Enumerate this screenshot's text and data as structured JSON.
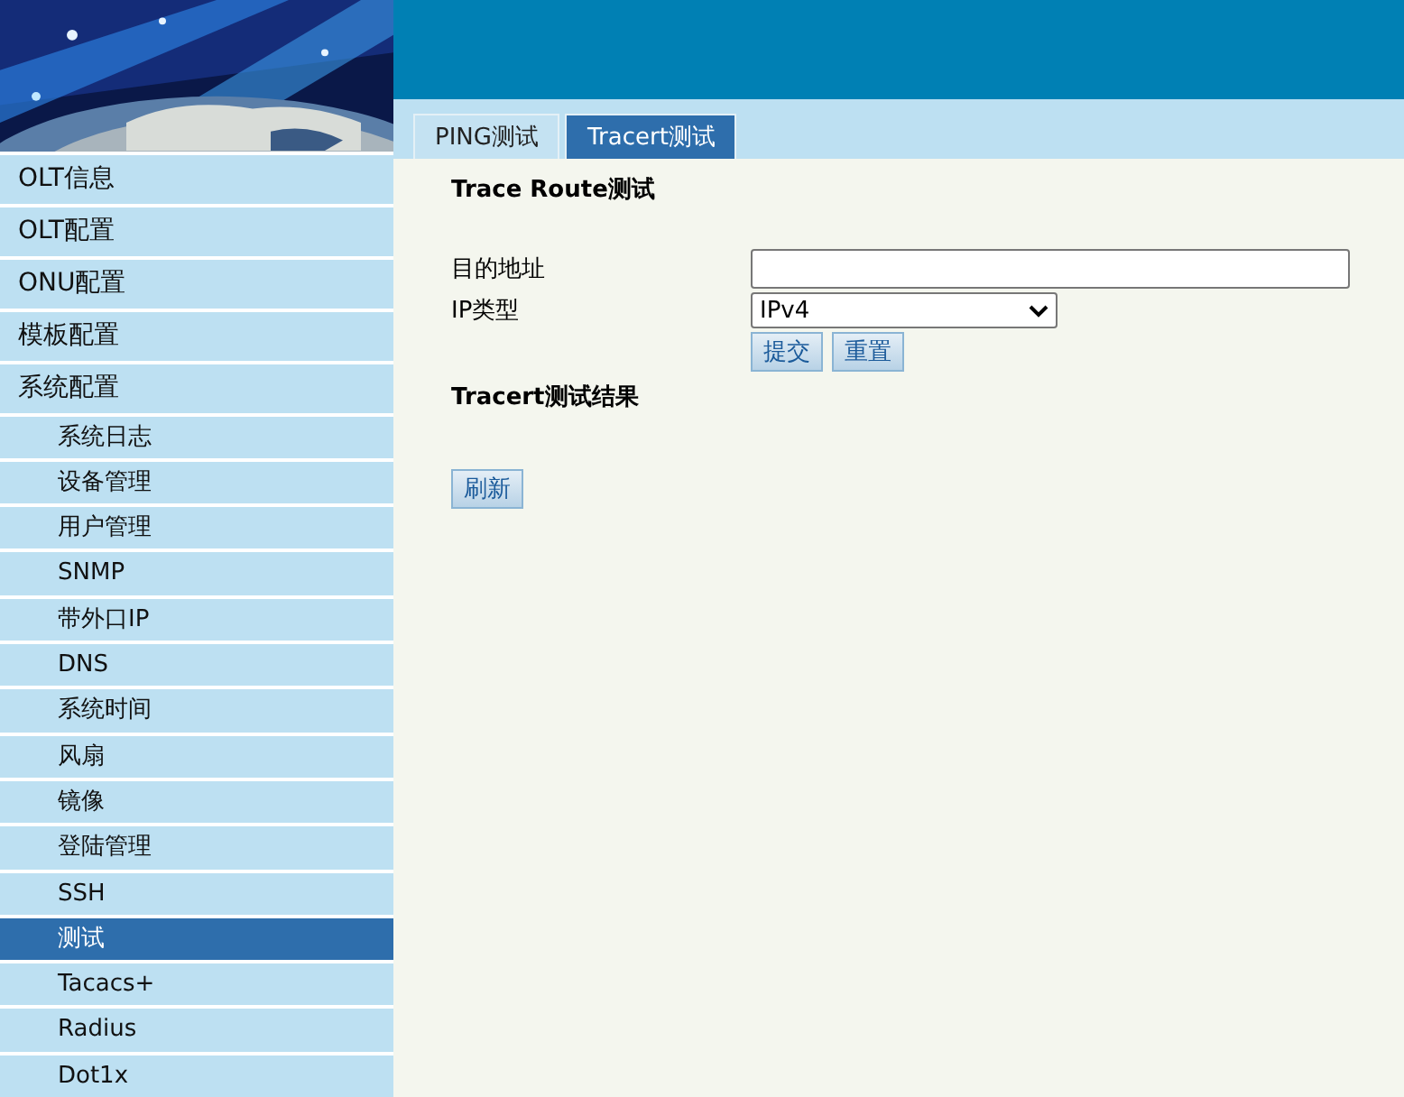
{
  "sidebar": {
    "items": [
      {
        "label": "OLT信息",
        "selected": false
      },
      {
        "label": "OLT配置",
        "selected": false
      },
      {
        "label": "ONU配置",
        "selected": false
      },
      {
        "label": "模板配置",
        "selected": false
      },
      {
        "label": "系统配置",
        "selected": false,
        "children": [
          {
            "label": "系统日志",
            "selected": false
          },
          {
            "label": "设备管理",
            "selected": false
          },
          {
            "label": "用户管理",
            "selected": false
          },
          {
            "label": "SNMP",
            "selected": false
          },
          {
            "label": "带外口IP",
            "selected": false
          },
          {
            "label": "DNS",
            "selected": false
          },
          {
            "label": "系统时间",
            "selected": false
          },
          {
            "label": "风扇",
            "selected": false
          },
          {
            "label": "镜像",
            "selected": false
          },
          {
            "label": "登陆管理",
            "selected": false
          },
          {
            "label": "SSH",
            "selected": false
          },
          {
            "label": "测试",
            "selected": true
          },
          {
            "label": "Tacacs+",
            "selected": false
          },
          {
            "label": "Radius",
            "selected": false
          },
          {
            "label": "Dot1x",
            "selected": false
          }
        ]
      }
    ]
  },
  "tabs": [
    {
      "label": "PING测试",
      "selected": false
    },
    {
      "label": "Tracert测试",
      "selected": true
    }
  ],
  "form": {
    "title": "Trace Route测试",
    "fields": [
      {
        "kind": "text",
        "label": "目的地址"
      },
      {
        "kind": "select",
        "label": "IP类型",
        "value": "IPv4"
      }
    ],
    "buttons": [
      "提交",
      "重置"
    ]
  },
  "results": {
    "title": "Tracert测试结果",
    "button": "刷新"
  }
}
